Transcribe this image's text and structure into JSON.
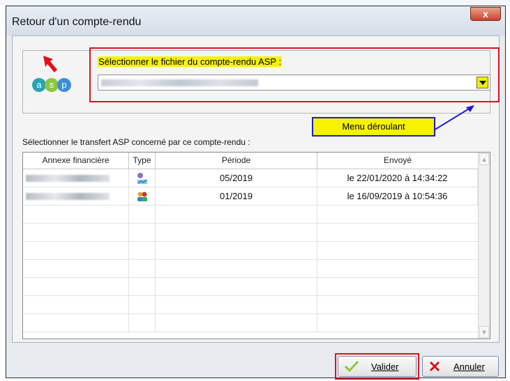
{
  "window": {
    "title": "Retour d'un compte-rendu",
    "close_glyph": "x"
  },
  "logo": {
    "icon": "asp-logo-icon",
    "letters": [
      "a",
      "s",
      "p"
    ]
  },
  "file_section": {
    "label": "Sélectionner le fichier du compte-rendu ASP :",
    "selected_value_redacted": true
  },
  "callout": {
    "text": "Menu déroulant"
  },
  "transfer_section": {
    "label": "Sélectionner le transfert ASP concerné par ce compte-rendu :",
    "columns": [
      "Annexe financière",
      "Type",
      "Période",
      "Envoyé"
    ],
    "rows": [
      {
        "annexe_redacted": true,
        "type_icon": "person-chart-icon",
        "periode": "05/2019",
        "envoye": "le 22/01/2020 à 14:34:22"
      },
      {
        "annexe_redacted": true,
        "type_icon": "group-people-icon",
        "periode": "01/2019",
        "envoye": "le 16/09/2019 à 10:54:36"
      }
    ],
    "empty_rows": 8
  },
  "buttons": {
    "validate_label": "Valider",
    "cancel_label": "Annuler"
  },
  "colors": {
    "highlight": "#f5f300",
    "annotation_red": "#e0111d",
    "annotation_blue": "#1d1dcc"
  }
}
